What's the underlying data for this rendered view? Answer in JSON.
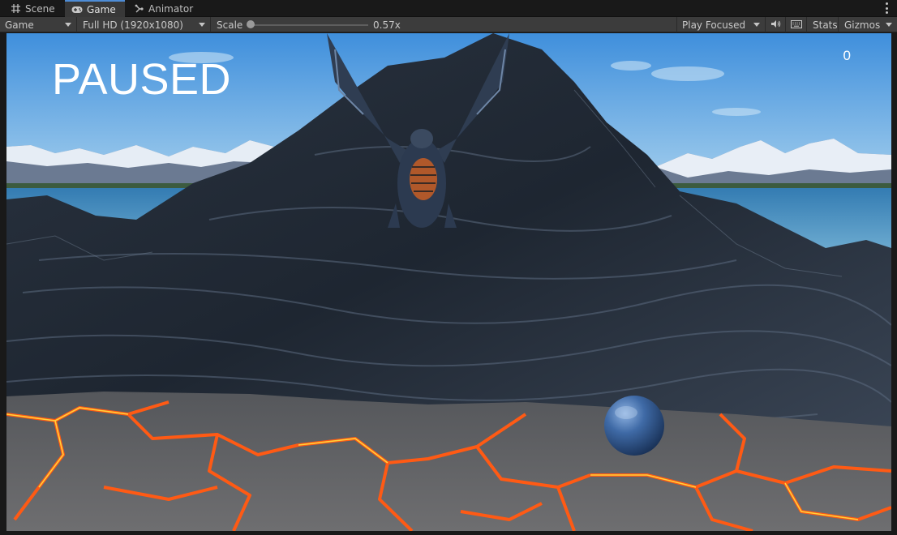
{
  "tabs": [
    {
      "label": "Scene",
      "icon": "grid-icon",
      "active": false
    },
    {
      "label": "Game",
      "icon": "gamepad-icon",
      "active": true
    },
    {
      "label": "Animator",
      "icon": "animator-icon",
      "active": false
    }
  ],
  "toolbar": {
    "display": "Game",
    "resolution": "Full HD (1920x1080)",
    "scale_label": "Scale",
    "scale_value": "0.57x",
    "play_mode": "Play Focused",
    "stats_label": "Stats",
    "gizmos_label": "Gizmos"
  },
  "game": {
    "paused_text": "PAUSED",
    "score": "0"
  },
  "colors": {
    "accent": "#4d8cd6",
    "lava": "#ff6a1a",
    "sky": "#6fb2e8"
  }
}
